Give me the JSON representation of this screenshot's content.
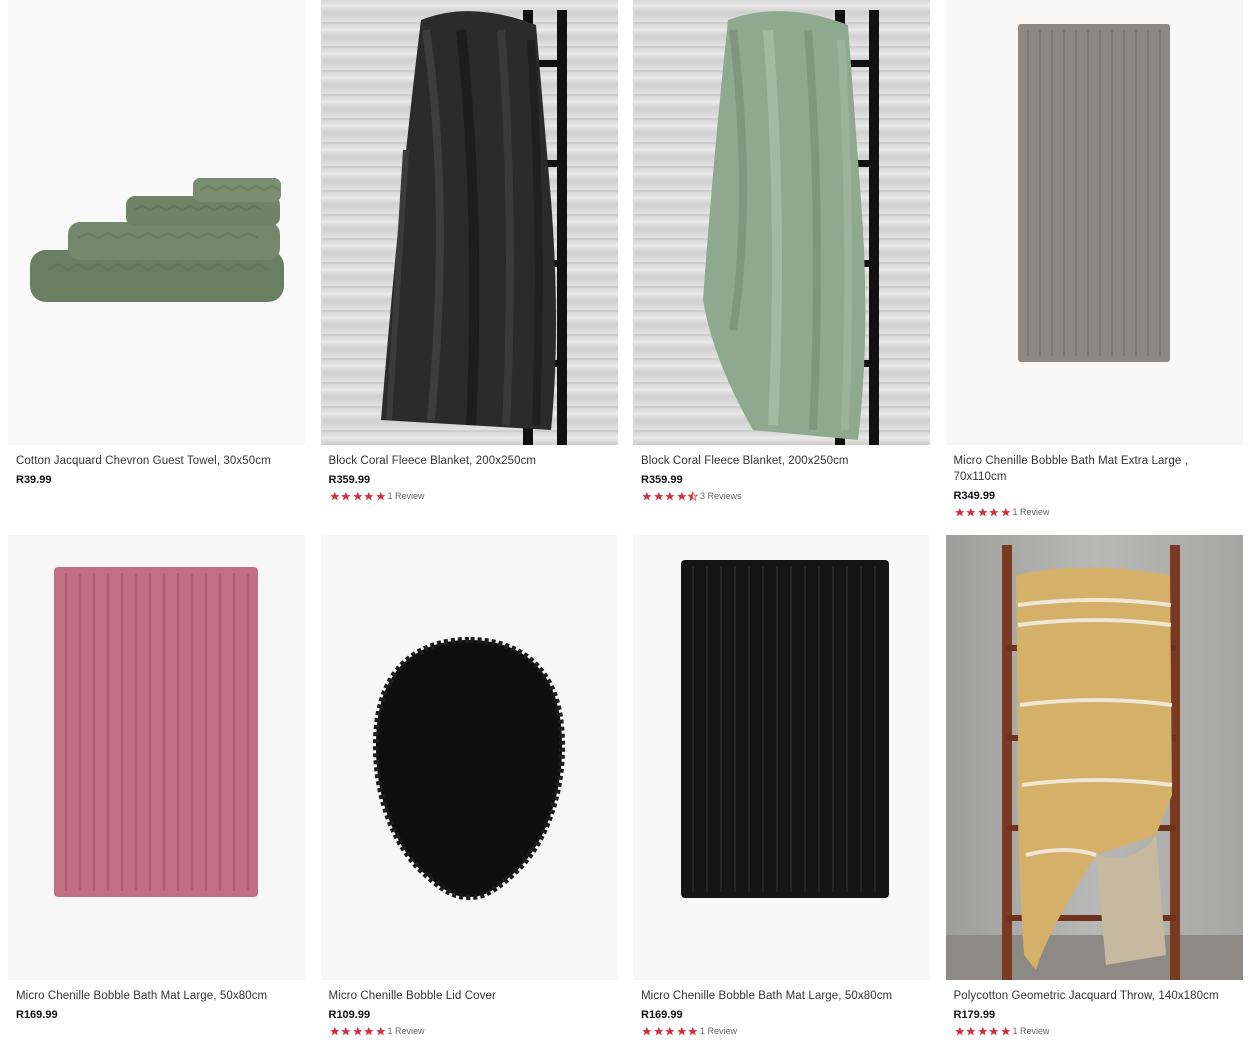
{
  "colors": {
    "star": "#d32f3c",
    "image_bg": "#f7f7f7",
    "towel_green": "#6f8467",
    "blanket_black": "#2a2a2a",
    "blanket_green": "#8fa98f",
    "mat_grey": "#8e8884",
    "mat_pink": "#c06f86",
    "lid_black": "#0e0e0e",
    "mat_black": "#151515",
    "throw_mustard": "#d5b068"
  },
  "products": [
    {
      "title": "Cotton Jacquard Chevron Guest Towel, 30x50cm",
      "price": "R39.99",
      "rating": null,
      "reviews": "",
      "image": "green-towel-stack"
    },
    {
      "title": "Block Coral Fleece Blanket, 200x250cm",
      "price": "R359.99",
      "rating": 5,
      "reviews": "1 Review",
      "image": "black-fleece-blanket"
    },
    {
      "title": "Block Coral Fleece Blanket, 200x250cm",
      "price": "R359.99",
      "rating": 4.5,
      "reviews": "3 Reviews",
      "image": "green-fleece-blanket"
    },
    {
      "title": "Micro Chenille Bobble Bath Mat Extra Large , 70x110cm",
      "price": "R349.99",
      "rating": 5,
      "reviews": "1 Review",
      "image": "grey-bath-mat"
    },
    {
      "title": "Micro Chenille Bobble Bath Mat Large, 50x80cm",
      "price": "R169.99",
      "rating": null,
      "reviews": "",
      "image": "pink-bath-mat"
    },
    {
      "title": "Micro Chenille Bobble Lid Cover",
      "price": "R109.99",
      "rating": 5,
      "reviews": "1 Review",
      "image": "black-lid-cover"
    },
    {
      "title": "Micro Chenille Bobble Bath Mat Large, 50x80cm",
      "price": "R169.99",
      "rating": 5,
      "reviews": "1 Review",
      "image": "black-bath-mat"
    },
    {
      "title": "Polycotton Geometric Jacquard Throw, 140x180cm",
      "price": "R179.99",
      "rating": 5,
      "reviews": "1 Review",
      "image": "mustard-throw"
    }
  ]
}
